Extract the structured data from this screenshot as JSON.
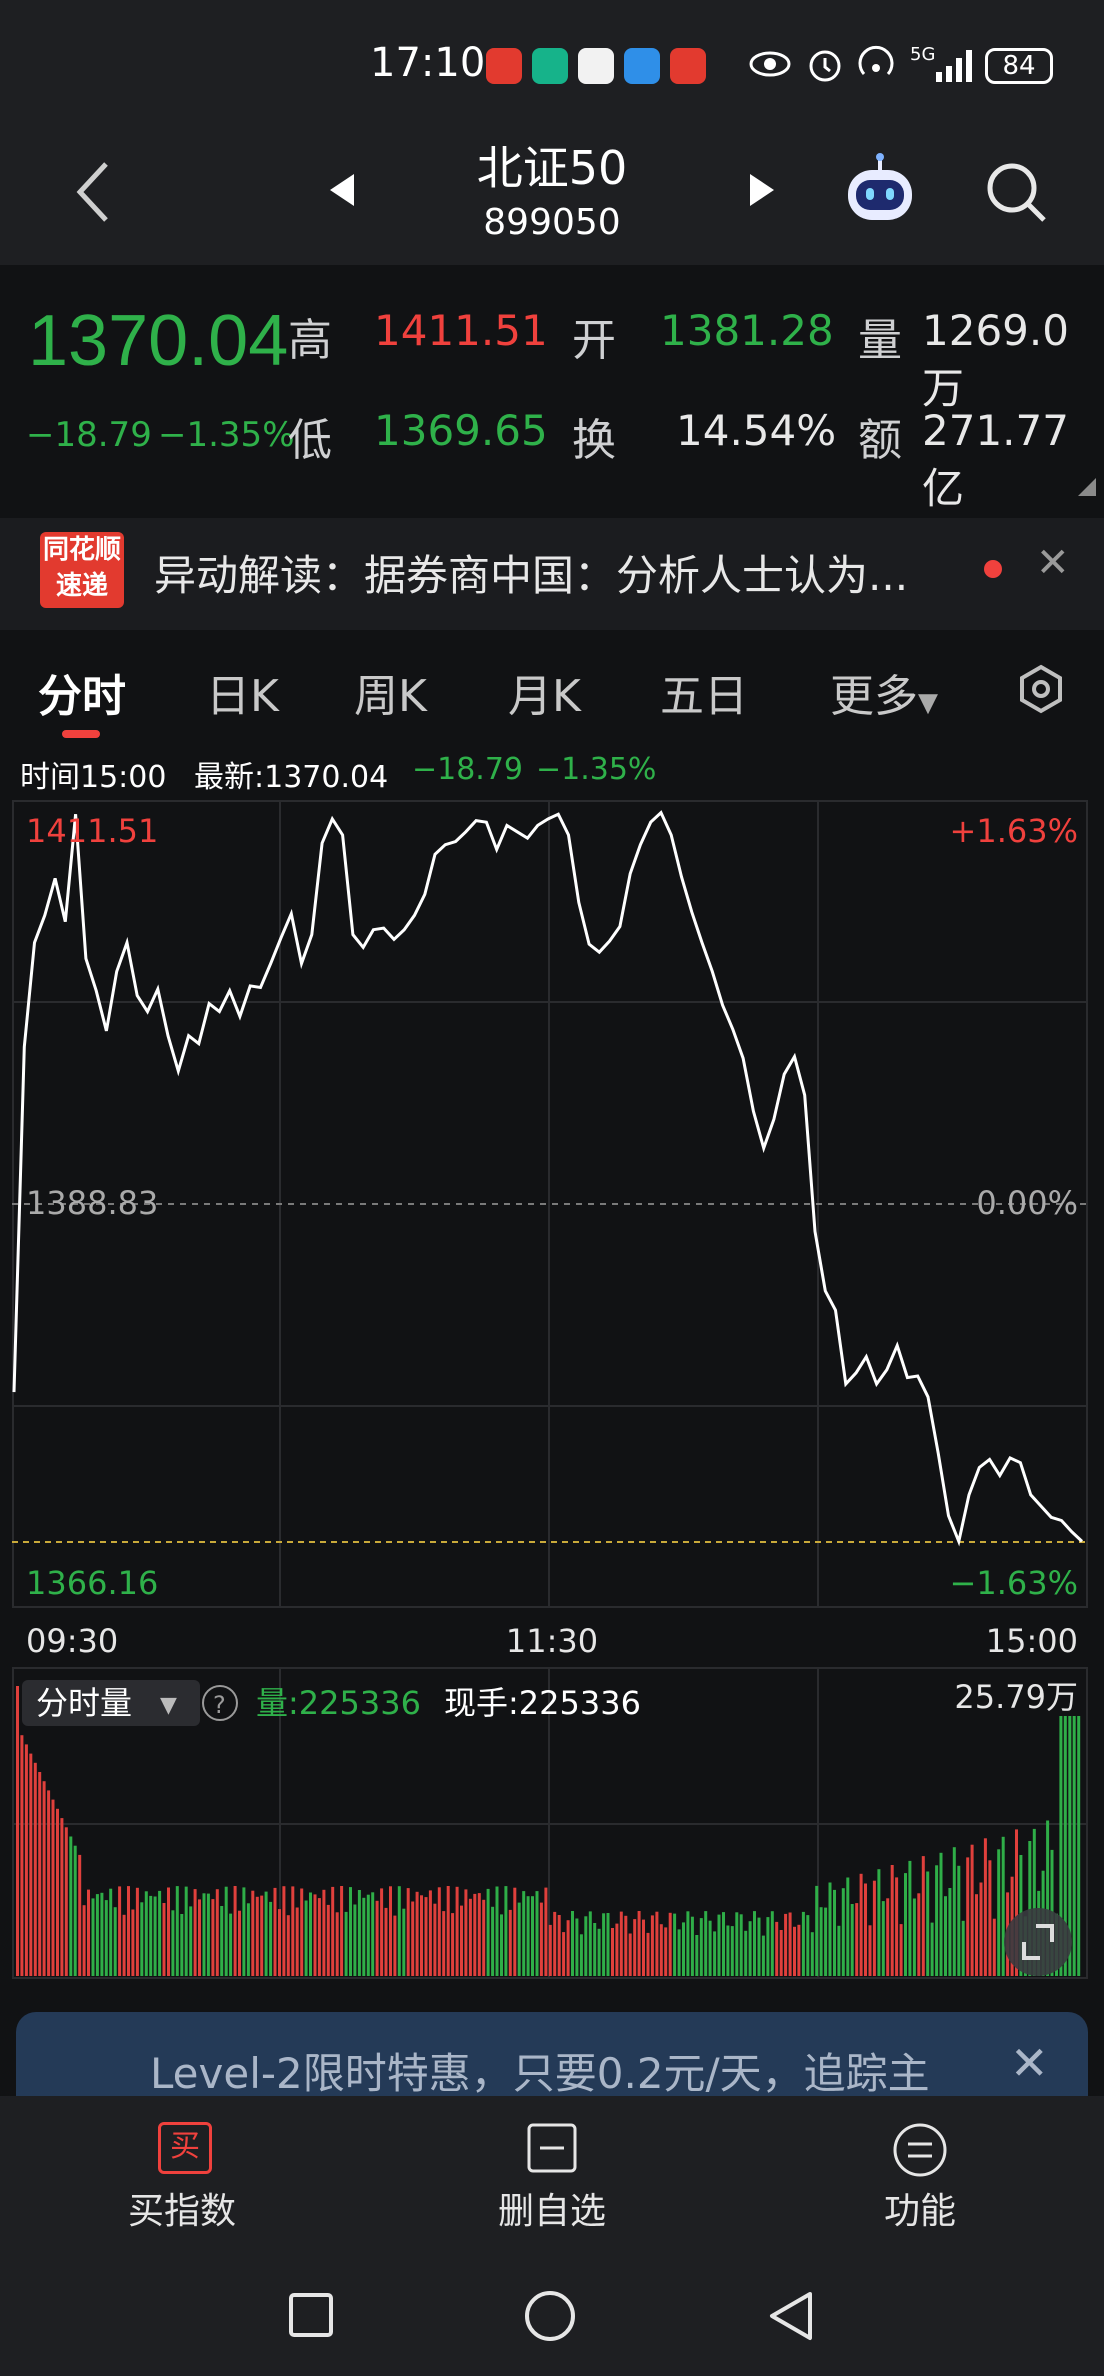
{
  "status_bar": {
    "time": "17:10",
    "network": "5G",
    "battery": "84",
    "colors": {
      "apps": [
        "#e23a2f",
        "#16b38a",
        "#d94b4b",
        "#2f8fe8",
        "#e23a2f"
      ]
    }
  },
  "nav": {
    "title": "北证50",
    "code": "899050"
  },
  "quote": {
    "price": "1370.04",
    "change": "−18.79",
    "change_pct": "−1.35%",
    "high_label": "高",
    "high": "1411.51",
    "open_label": "开",
    "open": "1381.28",
    "volume_label": "量",
    "volume": "1269.0万",
    "low_label": "低",
    "low": "1369.65",
    "turnover_label": "换",
    "turnover": "14.54%",
    "amount_label": "额",
    "amount": "271.77亿"
  },
  "news": {
    "logo_top": "同花顺",
    "logo_bottom": "速递",
    "text": "异动解读：据券商中国：分析人士认为..."
  },
  "tabs": [
    "分时",
    "日K",
    "周K",
    "月K",
    "五日",
    "更多"
  ],
  "info_line": {
    "time": "时间15:00",
    "latest": "最新:1370.04",
    "change": "−18.79",
    "pct": "−1.35%"
  },
  "chart_data": {
    "type": "line",
    "y_high": "1411.51",
    "y_mid": "1388.83",
    "y_low": "1366.16",
    "pct_high": "+1.63%",
    "pct_mid": "0.00%",
    "pct_low": "−1.63%",
    "x_ticks": [
      "09:30",
      "11:30",
      "15:00"
    ],
    "ylim": [
      1366.16,
      1411.51
    ],
    "prev_close": 1388.83,
    "price_series": [
      1375.5,
      1397,
      1403.5,
      1405.2,
      1407.5,
      1404.8,
      1411.5,
      1402.5,
      1400.5,
      1398,
      1401.7,
      1403.5,
      1400.2,
      1399.2,
      1400.6,
      1397.7,
      1395.5,
      1397.7,
      1397.2,
      1399.7,
      1399.2,
      1400.5,
      1398.9,
      1400.8,
      1400.7,
      1402.2,
      1403.8,
      1405.3,
      1402.2,
      1404,
      1409.7,
      1411.2,
      1410.2,
      1404,
      1403.2,
      1404.3,
      1404.4,
      1403.7,
      1404.3,
      1405.2,
      1406.5,
      1409,
      1409.6,
      1409.8,
      1410.4,
      1411.1,
      1411,
      1409.3,
      1410.8,
      1410.4,
      1410,
      1410.8,
      1411.2,
      1411.5,
      1410.2,
      1406,
      1403.4,
      1402.9,
      1403.6,
      1404.5,
      1407.8,
      1409.6,
      1411,
      1411.6,
      1410.2,
      1407.6,
      1405.4,
      1403.5,
      1401.7,
      1399.6,
      1398.1,
      1396.3,
      1393,
      1390.7,
      1392.5,
      1395.3,
      1396.4,
      1394,
      1385.5,
      1381.8,
      1380.6,
      1376,
      1376.7,
      1377.7,
      1376,
      1376.9,
      1378.4,
      1376.4,
      1376.5,
      1375.2,
      1371.7,
      1367.8,
      1366.2,
      1369.1,
      1370.8,
      1371.3,
      1370.3,
      1371.4,
      1371.1,
      1369.1,
      1368.4,
      1367.7,
      1367.5,
      1366.8,
      1366.2
    ],
    "vol_label": "分时量",
    "vol": "量:225336",
    "vol_now": "现手:225336",
    "vol_max": "25.79万"
  },
  "promo": {
    "text": "Level-2限时特惠，只要0.2元/天，追踪主"
  },
  "bottom_bar": {
    "buy": "买指数",
    "buy_icon": "买",
    "remove": "删自选",
    "func": "功能"
  }
}
